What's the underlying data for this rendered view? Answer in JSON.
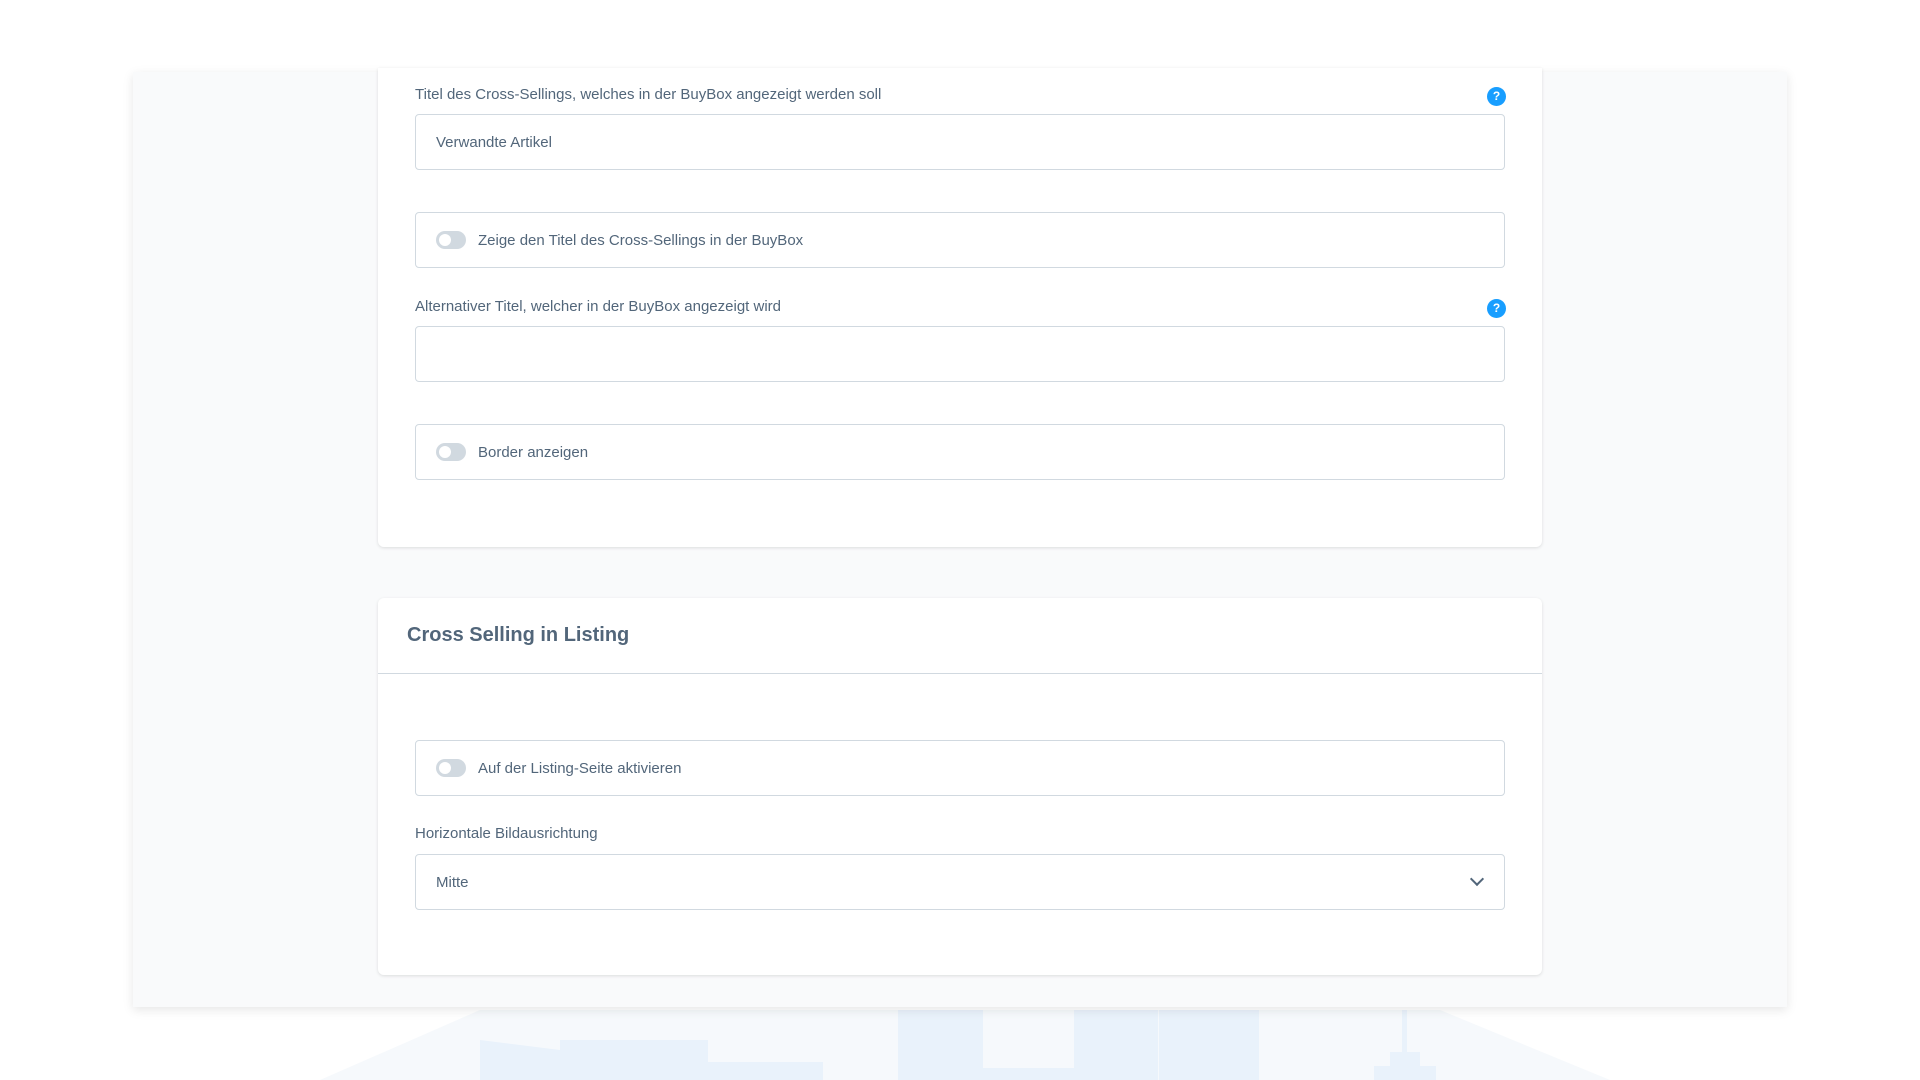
{
  "colors": {
    "accent": "#189eff",
    "text": "#52667a",
    "border": "#d1d9e0",
    "background": "#f9fafb"
  },
  "buybox_section": {
    "title_field": {
      "label": "Titel des Cross-Sellings, welches in der BuyBox angezeigt werden soll",
      "value": "Verwandte Artikel",
      "help_icon": "?"
    },
    "show_title_toggle": {
      "label": "Zeige den Titel des Cross-Sellings in der BuyBox",
      "checked": false
    },
    "alt_title_field": {
      "label": "Alternativer Titel, welcher in der BuyBox angezeigt wird",
      "value": "",
      "help_icon": "?"
    },
    "border_toggle": {
      "label": "Border anzeigen",
      "checked": false
    }
  },
  "listing_section": {
    "heading": "Cross Selling in Listing",
    "activate_toggle": {
      "label": "Auf der Listing-Seite aktivieren",
      "checked": false
    },
    "image_alignment": {
      "label": "Horizontale Bildausrichtung",
      "selected": "Mitte",
      "icon": "chevron-down-icon"
    }
  }
}
